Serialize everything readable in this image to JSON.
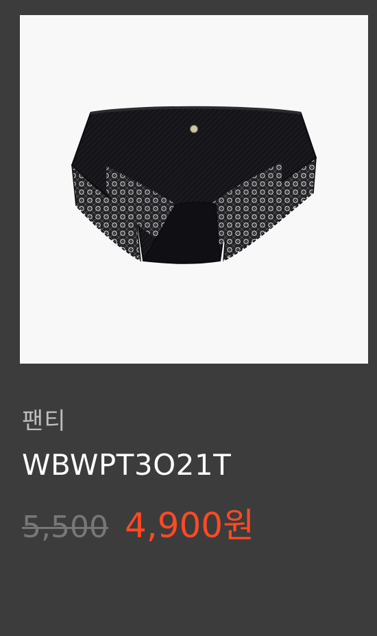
{
  "product": {
    "image_alt": "black lace panty",
    "category": "팬티",
    "name": "WBWPT3O21T",
    "original_price": "5,500",
    "sale_price": "4,900원"
  },
  "colors": {
    "background": "#3c3c3c",
    "image_background": "#f8f8f8",
    "category_text": "#bdbdbd",
    "name_text": "#ffffff",
    "original_price_text": "#777777",
    "sale_price_text": "#ff4a24"
  }
}
